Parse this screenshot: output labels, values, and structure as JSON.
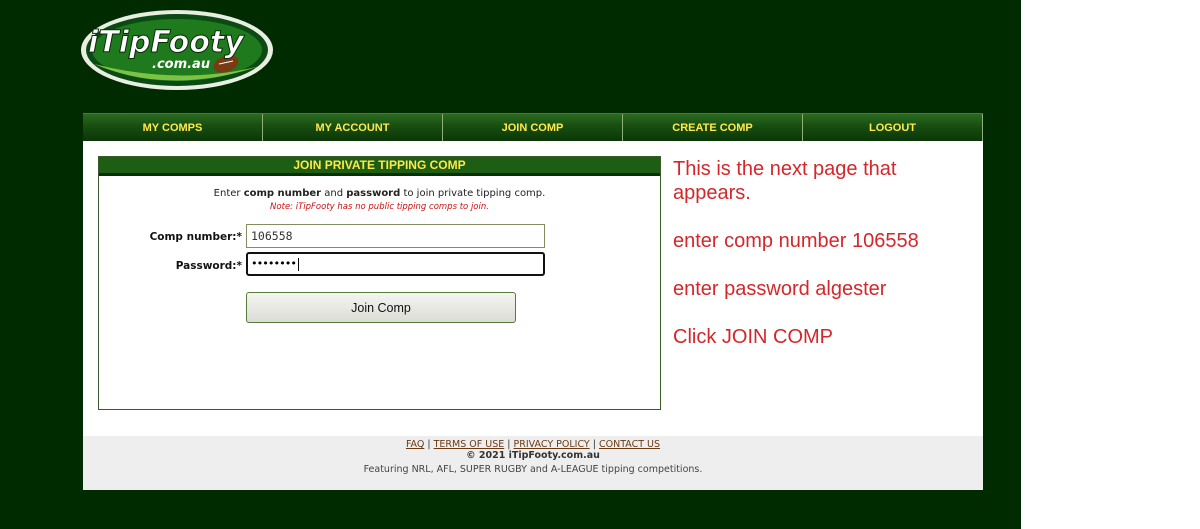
{
  "logo": {
    "text": "iTipFooty",
    "sub": ".com.au"
  },
  "nav": [
    {
      "label": "MY COMPS"
    },
    {
      "label": "MY ACCOUNT"
    },
    {
      "label": "JOIN COMP"
    },
    {
      "label": "CREATE COMP"
    },
    {
      "label": "LOGOUT"
    }
  ],
  "panel": {
    "title": "JOIN PRIVATE TIPPING COMP",
    "intro_pre": "Enter ",
    "intro_b1": "comp number",
    "intro_mid": " and ",
    "intro_b2": "password",
    "intro_post": " to join private tipping comp.",
    "note": "Note: iTipFooty has no public tipping comps to join.",
    "comp_label": "Comp number:*",
    "comp_value": "106558",
    "password_label": "Password:*",
    "password_mask": "••••••••",
    "submit": "Join Comp"
  },
  "instructions": [
    "This is the next page that appears.",
    "enter comp number 106558",
    "enter password algester",
    "Click JOIN COMP"
  ],
  "footer": {
    "links": [
      "FAQ",
      "TERMS OF USE",
      "PRIVACY POLICY",
      "CONTACT US"
    ],
    "separator": "|",
    "copyright": "© 2021 iTipFooty.com.au",
    "featuring": "Featuring NRL, AFL, SUPER RUGBY and A-LEAGUE tipping competitions."
  },
  "colors": {
    "background": "#002b00",
    "nav_text": "#ffe94a",
    "instructions": "#d3272b",
    "note": "#cc1111"
  }
}
